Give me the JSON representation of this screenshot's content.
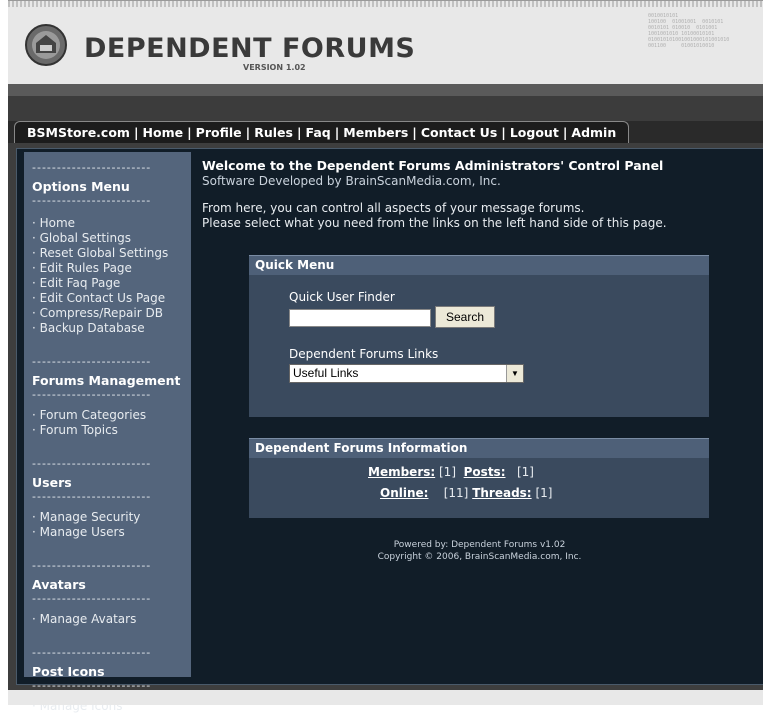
{
  "header": {
    "title": "DEPENDENT FORUMS",
    "version": "VERSION 1.02",
    "binary_lines": [
      "0010010101",
      "100100  01001001  0010101",
      "",
      "0010101 010010  0101001",
      "1001001010 10100010101",
      "010010101001001000101001010",
      "001100     01001010010"
    ]
  },
  "nav": {
    "items": [
      "BSMStore.com",
      "Home",
      "Profile",
      "Rules",
      "Faq",
      "Members",
      "Contact Us",
      "Logout",
      "Admin"
    ]
  },
  "sidebar": {
    "dashes": "------------------------",
    "sections": [
      {
        "heading": "Options Menu",
        "links": [
          "· Home",
          "· Global Settings",
          "· Reset Global Settings",
          "· Edit Rules Page",
          "· Edit Faq Page",
          "· Edit Contact Us Page",
          "· Compress/Repair DB",
          "· Backup Database"
        ]
      },
      {
        "heading": "Forums Management",
        "links": [
          "· Forum Categories",
          "· Forum Topics"
        ]
      },
      {
        "heading": "Users",
        "links": [
          "· Manage Security",
          "· Manage Users"
        ]
      },
      {
        "heading": "Avatars",
        "links": [
          "· Manage Avatars"
        ]
      },
      {
        "heading": "Post Icons",
        "links": [
          "· Manage Icons"
        ]
      }
    ]
  },
  "main": {
    "welcome_title": "Welcome to the Dependent Forums Administrators' Control Panel",
    "welcome_sub": "Software Developed by BrainScanMedia.com, Inc.",
    "body_line1": "From here, you can control all aspects of your message forums.",
    "body_line2": "Please select what you need from the links on the left hand side of this page."
  },
  "quick_menu": {
    "heading": "Quick Menu",
    "finder_label": "Quick User Finder",
    "finder_value": "",
    "search_button": "Search",
    "links_label": "Dependent Forums Links",
    "links_selected": "Useful Links"
  },
  "info": {
    "heading": "Dependent Forums Information",
    "members_label": "Members:",
    "members_value": "[1]",
    "posts_label": "Posts:",
    "posts_value": "[1]",
    "online_label": "Online:",
    "online_value": "[11]",
    "threads_label": "Threads:",
    "threads_value": "[1]"
  },
  "footer": {
    "line1": "Powered by: Dependent Forums v1.02",
    "line2": "Copyright © 2006, BrainScanMedia.com, Inc."
  },
  "colors": {
    "sidebar_bg": "#54657c",
    "content_bg": "#111d28",
    "panel_bg": "#3a4a5e",
    "panel_head_bg": "#4e6078",
    "nav_bg": "#1c1c1c"
  }
}
